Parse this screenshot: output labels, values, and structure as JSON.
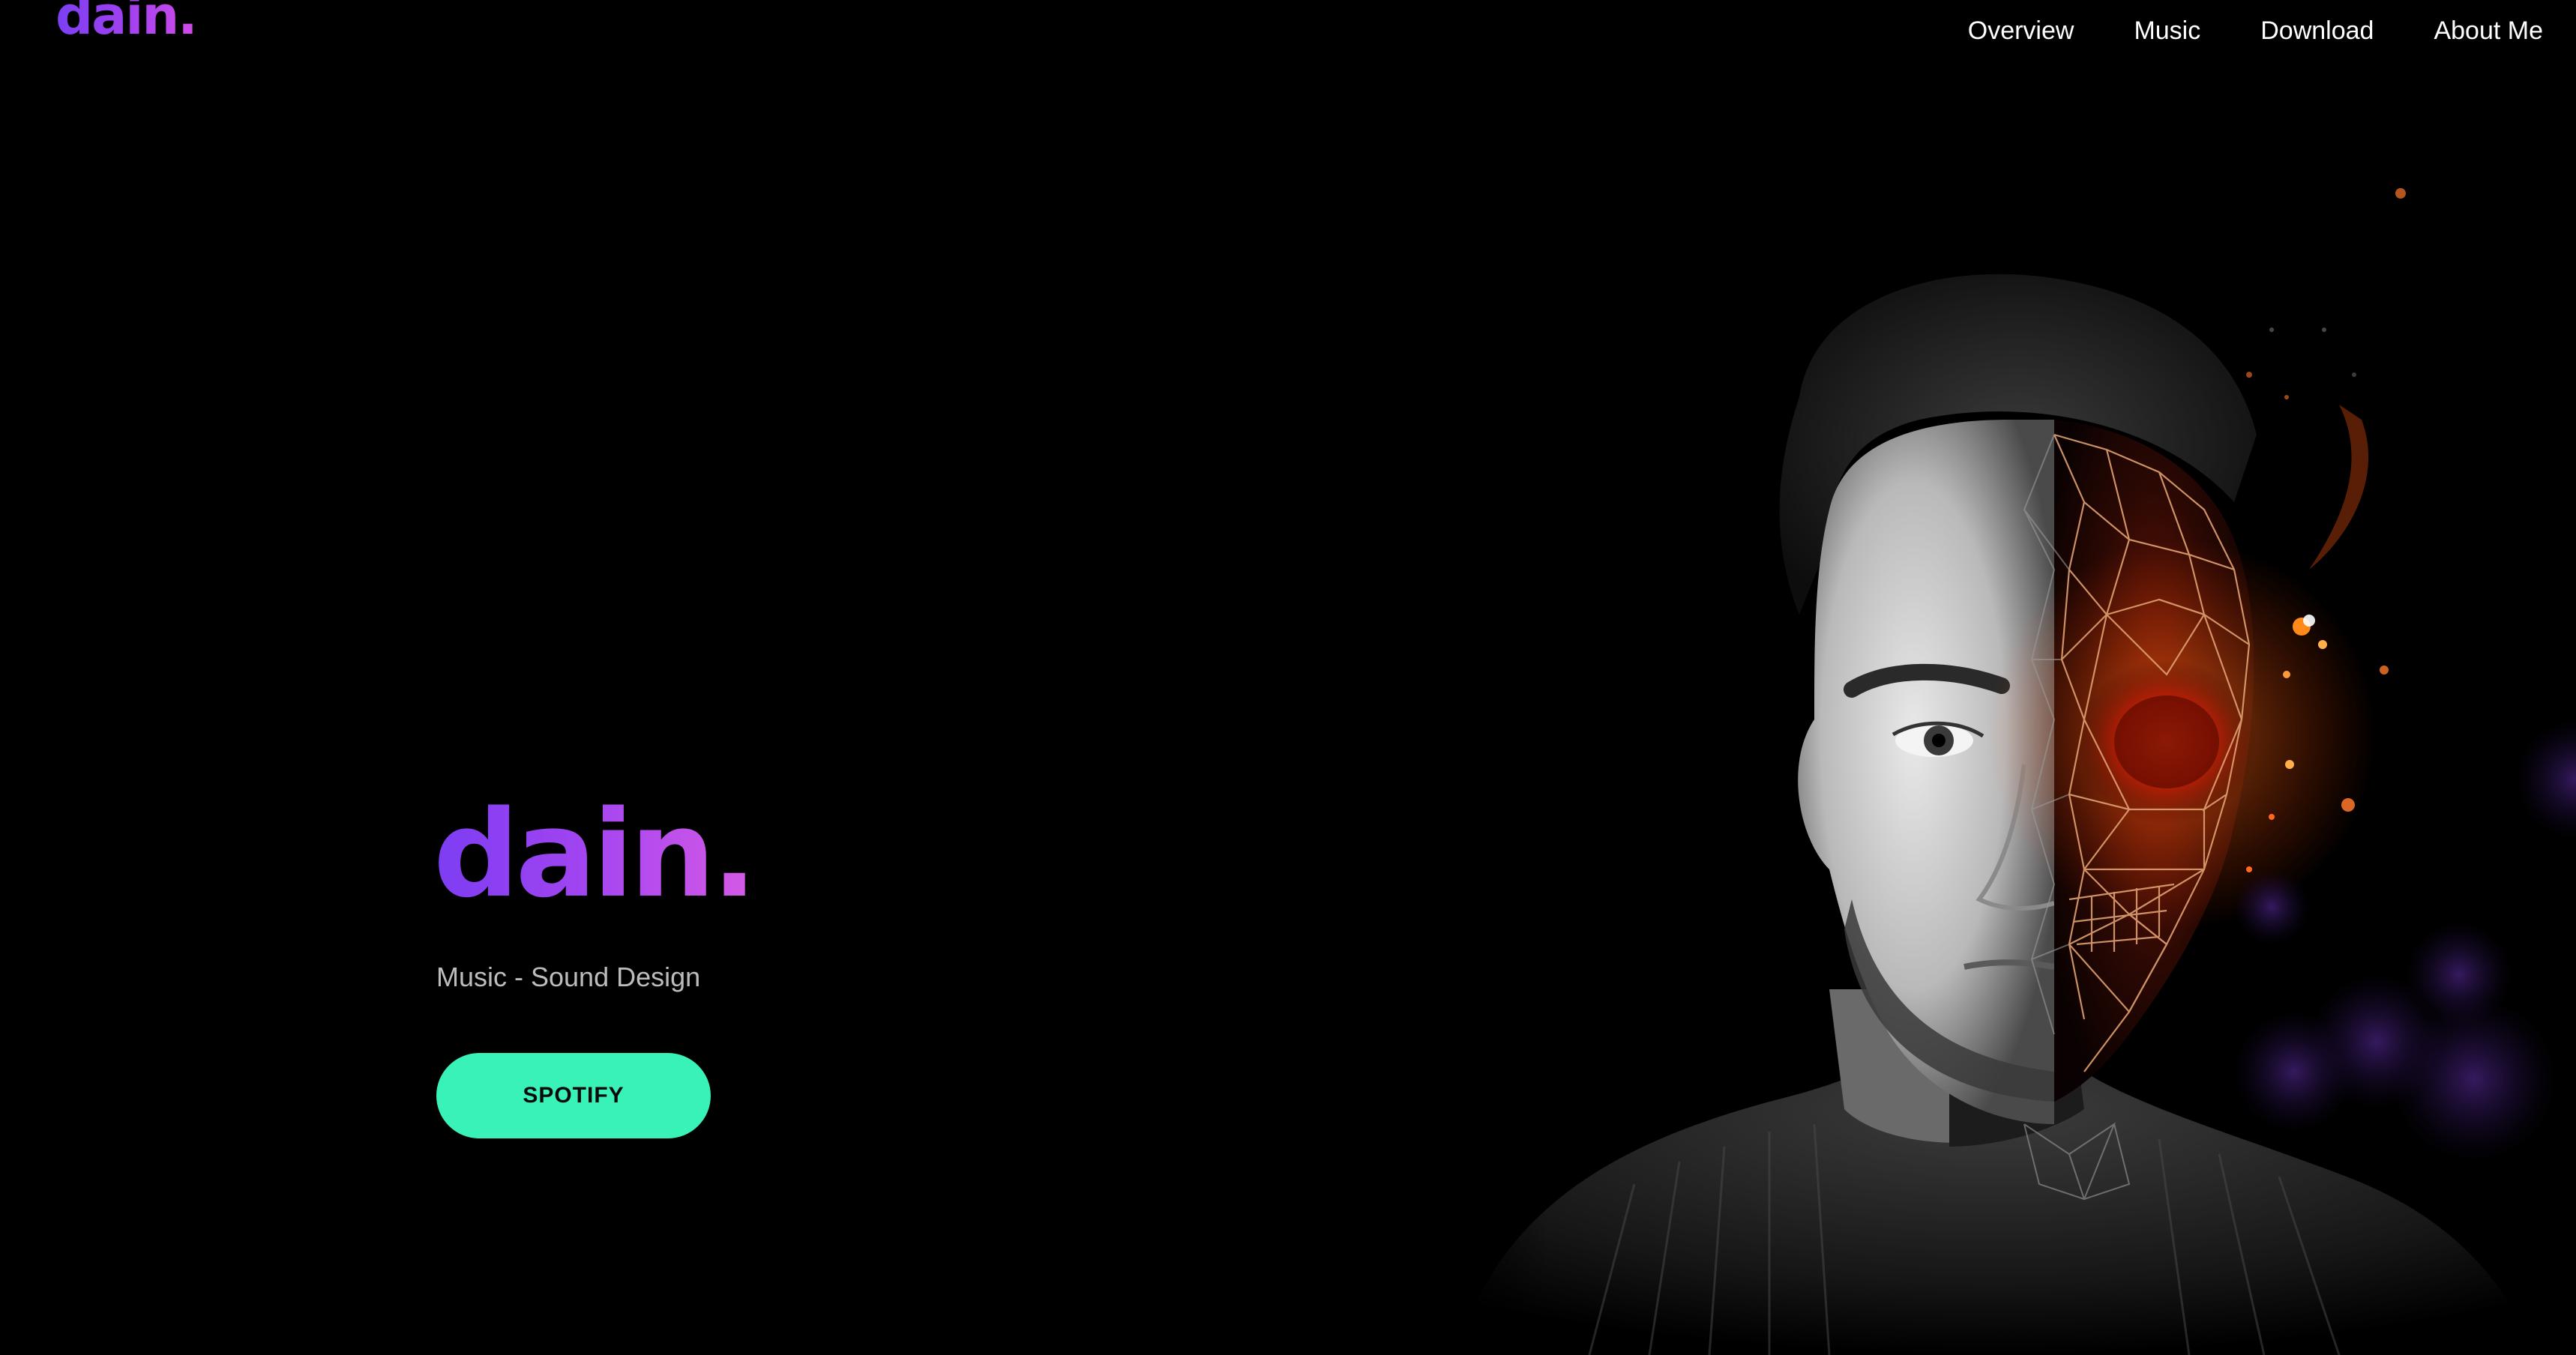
{
  "header": {
    "logo": "dain.",
    "nav": [
      "Overview",
      "Music",
      "Download",
      "About Me"
    ]
  },
  "hero": {
    "title": "dain.",
    "subtitle": "Music - Sound Design",
    "cta_label": "SPOTIFY"
  },
  "colors": {
    "background": "#000000",
    "brand_gradient_start": "#7b3ff2",
    "brand_gradient_end": "#d24be8",
    "cta": "#38f2b8",
    "subtitle": "#bdbdbd",
    "nav_text": "#ffffff"
  },
  "artwork": {
    "icon": "portrait-wireframe-skull-image"
  }
}
